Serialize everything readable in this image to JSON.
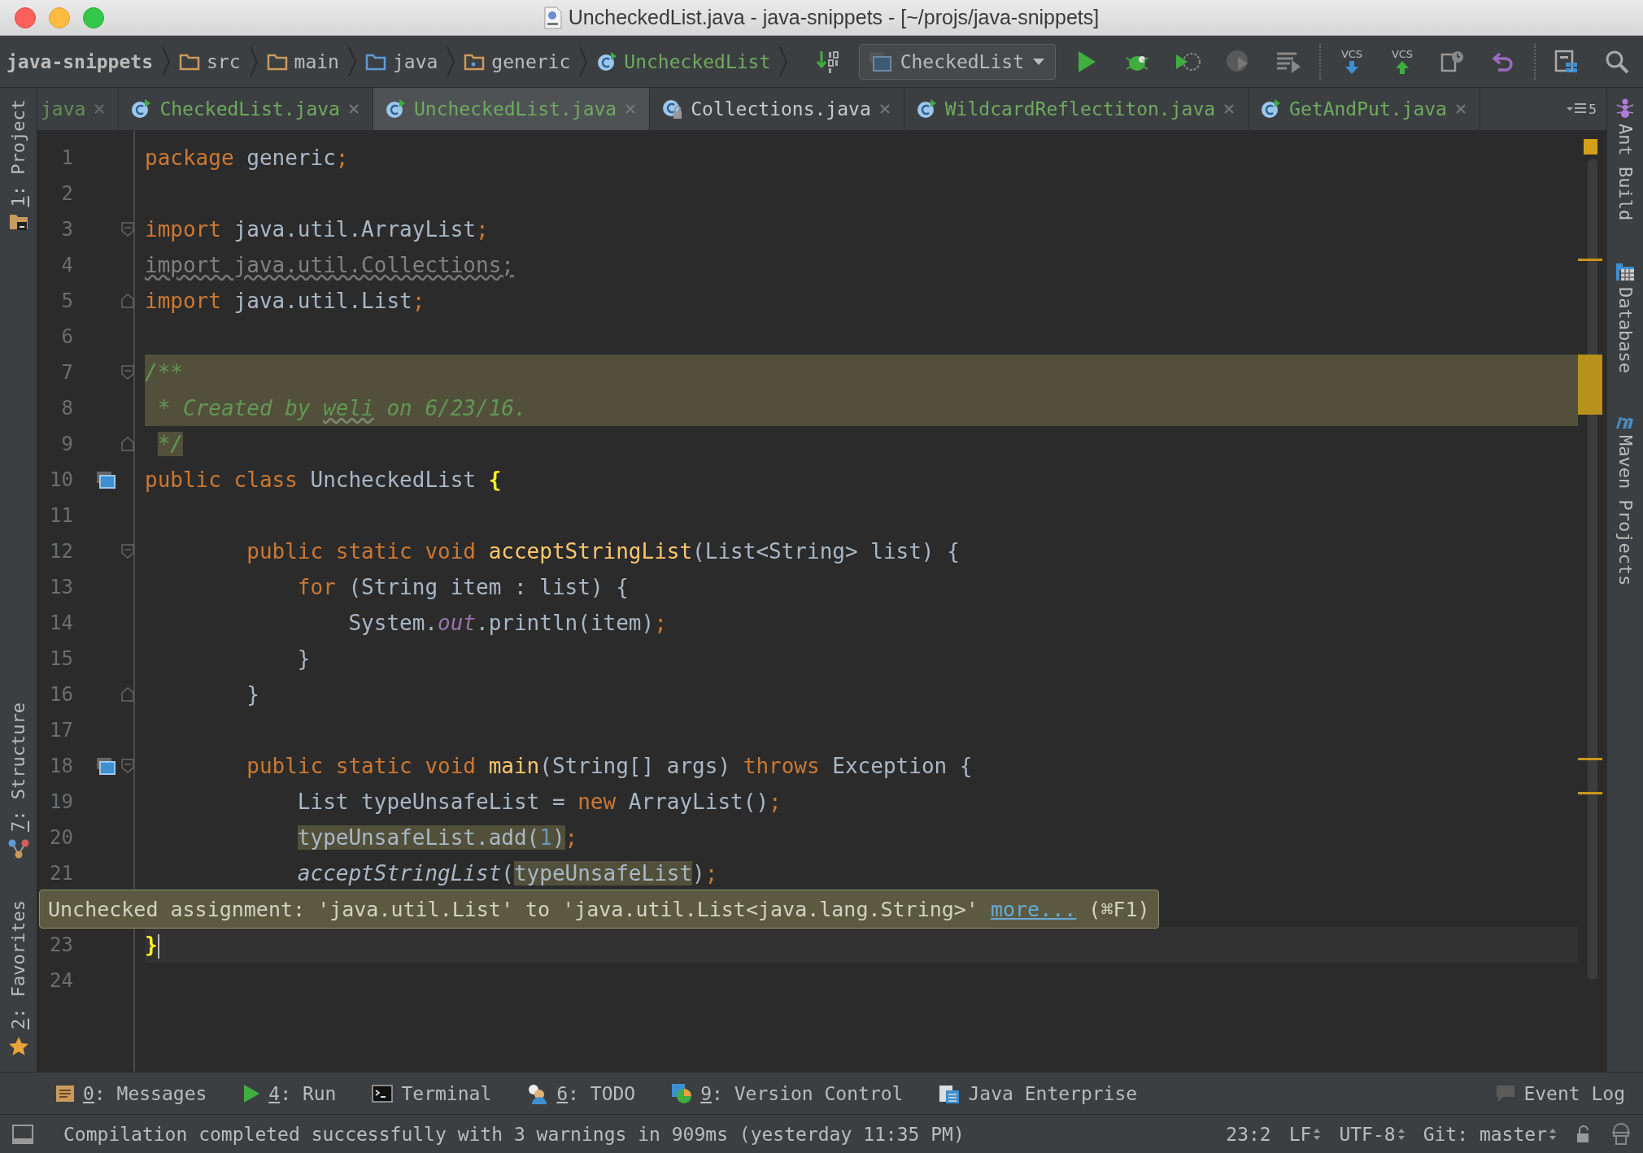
{
  "window": {
    "title": "UncheckedList.java - java-snippets - [~/projs/java-snippets]"
  },
  "breadcrumbs": [
    {
      "label": "java-snippets",
      "kind": "project"
    },
    {
      "label": "src",
      "kind": "folder"
    },
    {
      "label": "main",
      "kind": "folder"
    },
    {
      "label": "java",
      "kind": "source"
    },
    {
      "label": "generic",
      "kind": "package"
    },
    {
      "label": "UncheckedList",
      "kind": "class"
    }
  ],
  "run_config": {
    "label": "CheckedList"
  },
  "toolbar": [
    {
      "kind": "binary"
    },
    {
      "kind": "config"
    },
    {
      "kind": "run"
    },
    {
      "kind": "debug"
    },
    {
      "kind": "coverage"
    },
    {
      "kind": "profile"
    },
    {
      "kind": "build"
    },
    {
      "kind": "separator"
    },
    {
      "kind": "vcs-update",
      "label": "VCS"
    },
    {
      "kind": "vcs-commit",
      "label": "VCS"
    },
    {
      "kind": "history"
    },
    {
      "kind": "revert"
    },
    {
      "kind": "separator"
    },
    {
      "kind": "structure"
    },
    {
      "kind": "search"
    }
  ],
  "left_tools": [
    {
      "mnemonic": "1",
      "label": ": Project",
      "kind": "project"
    },
    {
      "mnemonic": "7",
      "label": ": Structure",
      "kind": "structure"
    },
    {
      "mnemonic": "2",
      "label": ": Favorites",
      "kind": "favorites"
    }
  ],
  "right_tools": [
    {
      "label": "Ant Build",
      "kind": "ant"
    },
    {
      "label": "Database",
      "kind": "database"
    },
    {
      "label": "Maven Projects",
      "kind": "maven"
    }
  ],
  "tabs": [
    {
      "label": "java",
      "kind": "partial",
      "selected": false
    },
    {
      "label": "CheckedList.java",
      "kind": "class",
      "selected": false
    },
    {
      "label": "UncheckedList.java",
      "kind": "class",
      "selected": true
    },
    {
      "label": "Collections.java",
      "kind": "library",
      "selected": false
    },
    {
      "label": "WildcardReflectiton.java",
      "kind": "class",
      "selected": false
    },
    {
      "label": "GetAndPut.java",
      "kind": "class",
      "selected": false
    }
  ],
  "tab_overflow": "5",
  "lines": [
    {
      "kind": "code",
      "number": "1",
      "tokens": [
        {
          "kind": "keyword",
          "text": "package"
        },
        {
          "kind": "plain",
          "text": " generic"
        },
        {
          "kind": "keyword",
          "text": ";"
        }
      ]
    },
    {
      "kind": "code",
      "number": "2"
    },
    {
      "kind": "code",
      "number": "3",
      "fold_start": true,
      "tokens": [
        {
          "kind": "keyword",
          "text": "import"
        },
        {
          "kind": "plain",
          "text": " java.util.ArrayList"
        },
        {
          "kind": "keyword",
          "text": ";"
        }
      ]
    },
    {
      "kind": "code",
      "number": "4",
      "tokens": [
        {
          "kind": "unused",
          "text": "import java.util.Collections;"
        }
      ]
    },
    {
      "kind": "code",
      "number": "5",
      "fold_end": true,
      "tokens": [
        {
          "kind": "keyword",
          "text": "import"
        },
        {
          "kind": "plain",
          "text": " java.util.List"
        },
        {
          "kind": "keyword",
          "text": ";"
        }
      ]
    },
    {
      "kind": "code",
      "number": "6"
    },
    {
      "kind": "code",
      "number": "7",
      "fold_start": true,
      "highlighted": true,
      "tokens": [
        {
          "kind": "comment",
          "text": "/**"
        }
      ]
    },
    {
      "kind": "code",
      "number": "8",
      "highlighted": true,
      "tokens": [
        {
          "kind": "comment",
          "text": " * Created by "
        },
        {
          "kind": "typo",
          "text": "weli"
        },
        {
          "kind": "comment",
          "text": " on 6/23/16."
        }
      ]
    },
    {
      "kind": "code",
      "number": "9",
      "fold_end": true,
      "tokens": [
        {
          "kind": "commentmarked",
          "text": " */"
        }
      ]
    },
    {
      "kind": "code",
      "number": "10",
      "run_marker": true,
      "tokens": [
        {
          "kind": "keyword",
          "text": "public class "
        },
        {
          "kind": "plain",
          "text": "UncheckedList "
        },
        {
          "kind": "brace",
          "text": "{"
        }
      ]
    },
    {
      "kind": "code",
      "number": "11"
    },
    {
      "kind": "code",
      "number": "12",
      "fold_start": true,
      "tokens": [
        {
          "kind": "keyword",
          "text": "        public static void "
        },
        {
          "kind": "method",
          "text": "acceptStringList"
        },
        {
          "kind": "plain",
          "text": "(List<String> list) {"
        }
      ]
    },
    {
      "kind": "code",
      "number": "13",
      "tokens": [
        {
          "kind": "keyword",
          "text": "            for "
        },
        {
          "kind": "plain",
          "text": "(String item : list) {"
        }
      ]
    },
    {
      "kind": "code",
      "number": "14",
      "tokens": [
        {
          "kind": "plain",
          "text": "                System."
        },
        {
          "kind": "field",
          "text": "out"
        },
        {
          "kind": "plain",
          "text": ".println(item)"
        },
        {
          "kind": "keyword",
          "text": ";"
        }
      ]
    },
    {
      "kind": "code",
      "number": "15",
      "tokens": [
        {
          "kind": "plain",
          "text": "            }"
        }
      ]
    },
    {
      "kind": "code",
      "number": "16",
      "fold_end": true,
      "tokens": [
        {
          "kind": "plain",
          "text": "        }"
        }
      ]
    },
    {
      "kind": "code",
      "number": "17"
    },
    {
      "kind": "code",
      "number": "18",
      "run_marker": true,
      "fold_start": true,
      "tokens": [
        {
          "kind": "keyword",
          "text": "        public static void "
        },
        {
          "kind": "method",
          "text": "main"
        },
        {
          "kind": "plain",
          "text": "(String[] args) "
        },
        {
          "kind": "keyword",
          "text": "throws "
        },
        {
          "kind": "plain",
          "text": "Exception {"
        }
      ]
    },
    {
      "kind": "code",
      "number": "19",
      "tokens": [
        {
          "kind": "plain",
          "text": "            List typeUnsafeList = "
        },
        {
          "kind": "keyword",
          "text": "new "
        },
        {
          "kind": "plain",
          "text": "ArrayList()"
        },
        {
          "kind": "keyword",
          "text": ";"
        }
      ]
    },
    {
      "kind": "code",
      "number": "20",
      "tokens": [
        {
          "kind": "warned",
          "text": "            typeUnsafeList.add("
        },
        {
          "kind": "warnednum",
          "text": "1"
        },
        {
          "kind": "warned",
          "text": ")"
        },
        {
          "kind": "keyword",
          "text": ";"
        }
      ]
    },
    {
      "kind": "code",
      "number": "21",
      "tokens": [
        {
          "kind": "call",
          "text": "            acceptStringList"
        },
        {
          "kind": "plain",
          "text": "("
        },
        {
          "kind": "warned",
          "text": "typeUnsafeList"
        },
        {
          "kind": "plain",
          "text": ")"
        },
        {
          "kind": "keyword",
          "text": ";"
        }
      ]
    },
    {
      "kind": "tooltip",
      "text": "Unchecked assignment: 'java.util.List' to 'java.util.List<java.lang.String>'",
      "link": "more...",
      "shortcut": "(⌘F1)"
    },
    {
      "kind": "code",
      "number": "23",
      "current": true,
      "tokens": [
        {
          "kind": "brace",
          "text": "}"
        }
      ]
    },
    {
      "kind": "code",
      "number": "24"
    }
  ],
  "bottom_tools": [
    {
      "mnemonic": "0",
      "label": ": Messages",
      "kind": "messages"
    },
    {
      "mnemonic": "4",
      "label": ": Run",
      "kind": "run"
    },
    {
      "label": "Terminal",
      "kind": "terminal"
    },
    {
      "mnemonic": "6",
      "label": ": TODO",
      "kind": "todo"
    },
    {
      "mnemonic": "9",
      "label": ": Version Control",
      "kind": "vcs"
    },
    {
      "label": "Java Enterprise",
      "kind": "javaee"
    }
  ],
  "event_log": {
    "label": "Event Log"
  },
  "status_bar": {
    "message": "Compilation completed successfully with 3 warnings in 909ms (yesterday 11:35 PM)",
    "position": "23:2",
    "items": [
      {
        "label": "LF"
      },
      {
        "label": "UTF-8"
      },
      {
        "label": "Git: master"
      }
    ]
  }
}
